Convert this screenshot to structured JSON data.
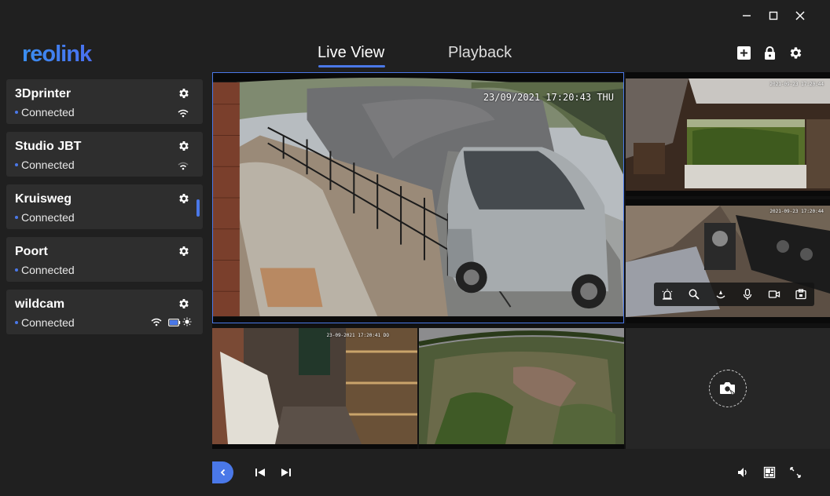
{
  "app": {
    "brand": "reolink",
    "accent": "#4a78e8"
  },
  "window_controls": [
    "minimize-icon",
    "maximize-icon",
    "close-icon"
  ],
  "tabs": [
    {
      "label": "Live View",
      "active": true
    },
    {
      "label": "Playback",
      "active": false
    }
  ],
  "top_actions": [
    "add-device-icon",
    "lock-icon",
    "gear-icon"
  ],
  "cameras": [
    {
      "name": "3Dprinter",
      "status": "Connected",
      "icons": [
        "wifi-icon"
      ]
    },
    {
      "name": "Studio JBT",
      "status": "Connected",
      "icons": [
        "wifi-weak-icon"
      ]
    },
    {
      "name": "Kruisweg",
      "status": "Connected",
      "icons": []
    },
    {
      "name": "Poort",
      "status": "Connected",
      "icons": []
    },
    {
      "name": "wildcam",
      "status": "Connected",
      "icons": [
        "wifi-icon",
        "battery-icon",
        "sun-icon"
      ]
    }
  ],
  "tiles": {
    "main_timestamp": "23/09/2021 17:20:43 THU",
    "t2_timestamp": "2021-09-23 17:20:44",
    "t3_timestamp": "2021-09-23 17:20:44",
    "t4_timestamp": "23-09-2021 17:20:41 DO"
  },
  "tile_toolbar": [
    "alarm-icon",
    "zoom-icon",
    "ptz-icon",
    "microphone-icon",
    "record-icon",
    "snapshot-save-icon"
  ],
  "bottom_bar": {
    "left": [
      "collapse-sidebar-icon",
      "previous-icon",
      "next-icon"
    ],
    "right": [
      "volume-icon",
      "layout-icon",
      "fullscreen-icon"
    ]
  }
}
